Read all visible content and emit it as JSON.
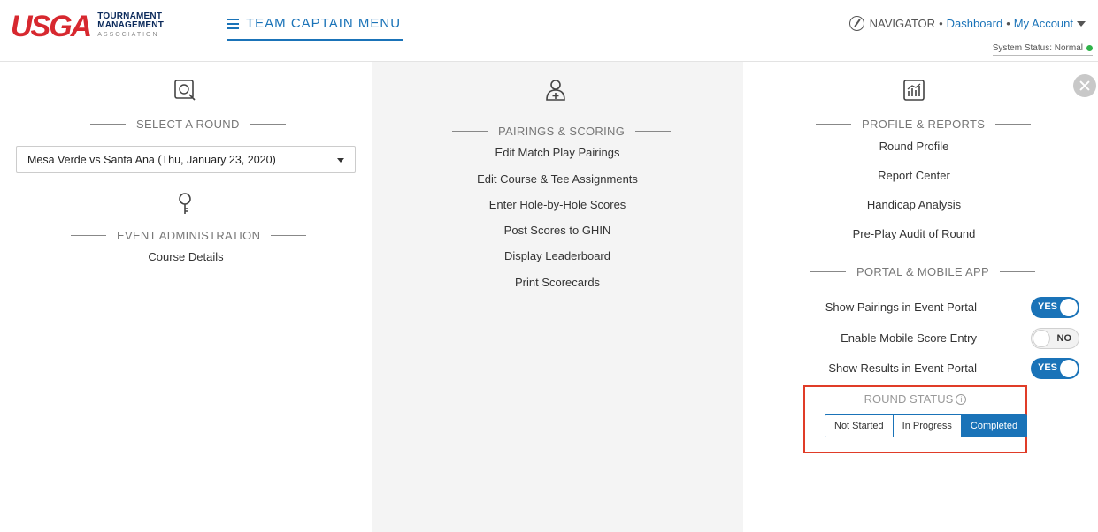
{
  "header": {
    "logo_main": "USGA",
    "logo_line1": "TOURNAMENT",
    "logo_line2": "MANAGEMENT",
    "logo_line3": "ASSOCIATION",
    "menu_label": "TEAM CAPTAIN MENU",
    "nav_label": "NAVIGATOR",
    "sep": "•",
    "dashboard_link": "Dashboard",
    "account_link": "My Account",
    "system_status": "System Status: Normal",
    "status_color": "#2fb34a"
  },
  "left": {
    "select_round_title": "SELECT A ROUND",
    "round_value": "Mesa Verde vs Santa Ana (Thu, January 23, 2020)",
    "event_admin_title": "EVENT ADMINISTRATION",
    "event_links": [
      "Course Details"
    ]
  },
  "middle": {
    "title": "PAIRINGS & SCORING",
    "links": [
      "Edit Match Play Pairings",
      "Edit Course & Tee Assignments",
      "Enter Hole-by-Hole Scores",
      "Post Scores to GHIN",
      "Display Leaderboard",
      "Print Scorecards"
    ]
  },
  "right": {
    "profile_title": "PROFILE & REPORTS",
    "profile_links": [
      "Round Profile",
      "Report Center",
      "Handicap Analysis",
      "Pre-Play Audit of Round"
    ],
    "portal_title": "PORTAL & MOBILE APP",
    "toggles": [
      {
        "label": "Show Pairings in Event Portal",
        "state": "YES",
        "on": true
      },
      {
        "label": "Enable Mobile Score Entry",
        "state": "NO",
        "on": false
      },
      {
        "label": "Show Results in Event Portal",
        "state": "YES",
        "on": true
      }
    ],
    "round_status_title": "ROUND STATUS",
    "info_glyph": "i",
    "round_status_options": [
      "Not Started",
      "In Progress",
      "Completed"
    ],
    "round_status_selected": "Completed"
  },
  "colors": {
    "accent": "#1a73b8",
    "brand_red": "#d7282f",
    "highlight_border": "#e03c28"
  }
}
